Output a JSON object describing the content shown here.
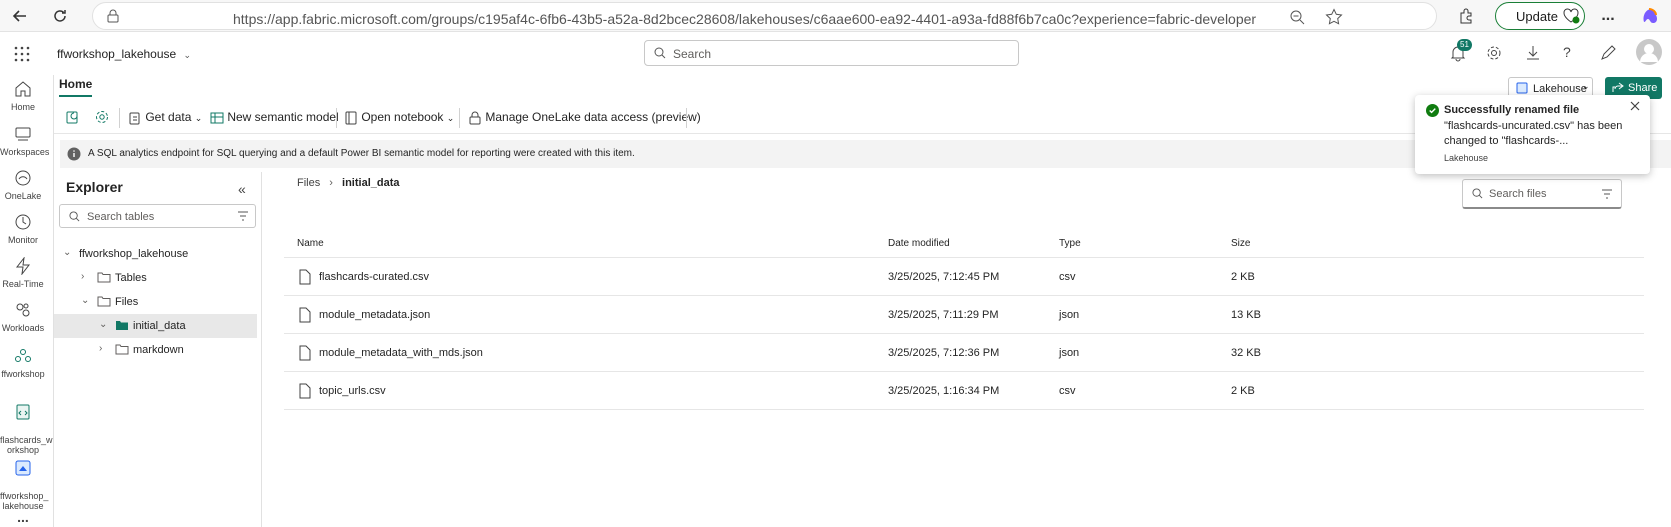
{
  "browser": {
    "url_host": "https://app.fabric.microsoft.com",
    "url_path": "/groups/c195af4c-6fb6-43b5-a52a-8d2bcec28608/lakehouses/c6aae600-ea92-4401-a93a-fd88f6b7ca0c?experience=fabric-developer",
    "update_label": "Update",
    "more_label": "..."
  },
  "header": {
    "workspace_name": "ffworkshop_lakehouse",
    "search_placeholder": "Search",
    "notification_count": "51"
  },
  "rail": {
    "items": [
      {
        "label": "Home",
        "icon": "home-icon"
      },
      {
        "label": "Workspaces",
        "icon": "workspaces-icon"
      },
      {
        "label": "OneLake",
        "icon": "onelake-icon"
      },
      {
        "label": "Monitor",
        "icon": "monitor-icon"
      },
      {
        "label": "Real-Time",
        "icon": "realtime-icon"
      },
      {
        "label": "Workloads",
        "icon": "workloads-icon"
      },
      {
        "label": "ffworkshop",
        "icon": "workspace-icon"
      },
      {
        "label": "flashcards_w\norkshop",
        "icon": "notebook-icon"
      },
      {
        "label": "ffworkshop_\nlakehouse",
        "icon": "lakehouse-icon"
      }
    ],
    "more_label": "..."
  },
  "ribbon": {
    "tab_home": "Home",
    "get_data": "Get data",
    "new_semantic_model": "New semantic model",
    "open_notebook": "Open notebook",
    "manage_onelake": "Manage OneLake data access (preview)",
    "lakehouse_label": "Lakehouse",
    "share_label": "Share"
  },
  "infobar": {
    "text": "A SQL analytics endpoint for SQL querying and a default Power BI semantic model for reporting were created with this item."
  },
  "explorer": {
    "title": "Explorer",
    "search_placeholder": "Search tables",
    "tree": {
      "root": "ffworkshop_lakehouse",
      "tables": "Tables",
      "files": "Files",
      "initial_data": "initial_data",
      "markdown": "markdown"
    }
  },
  "main": {
    "breadcrumb_root": "Files",
    "breadcrumb_current": "initial_data",
    "search_placeholder": "Search files",
    "columns": {
      "name": "Name",
      "date": "Date modified",
      "type": "Type",
      "size": "Size"
    },
    "rows": [
      {
        "name": "flashcards-curated.csv",
        "date": "3/25/2025, 7:12:45 PM",
        "type": "csv",
        "size": "2 KB"
      },
      {
        "name": "module_metadata.json",
        "date": "3/25/2025, 7:11:29 PM",
        "type": "json",
        "size": "13 KB"
      },
      {
        "name": "module_metadata_with_mds.json",
        "date": "3/25/2025, 7:12:36 PM",
        "type": "json",
        "size": "32 KB"
      },
      {
        "name": "topic_urls.csv",
        "date": "3/25/2025, 1:16:34 PM",
        "type": "csv",
        "size": "2 KB"
      }
    ]
  },
  "toast": {
    "title": "Successfully renamed file",
    "message": "\"flashcards-uncurated.csv\" has been changed to \"flashcards-...",
    "source": "Lakehouse"
  },
  "colors": {
    "accent": "#117865",
    "success": "#107c10"
  }
}
